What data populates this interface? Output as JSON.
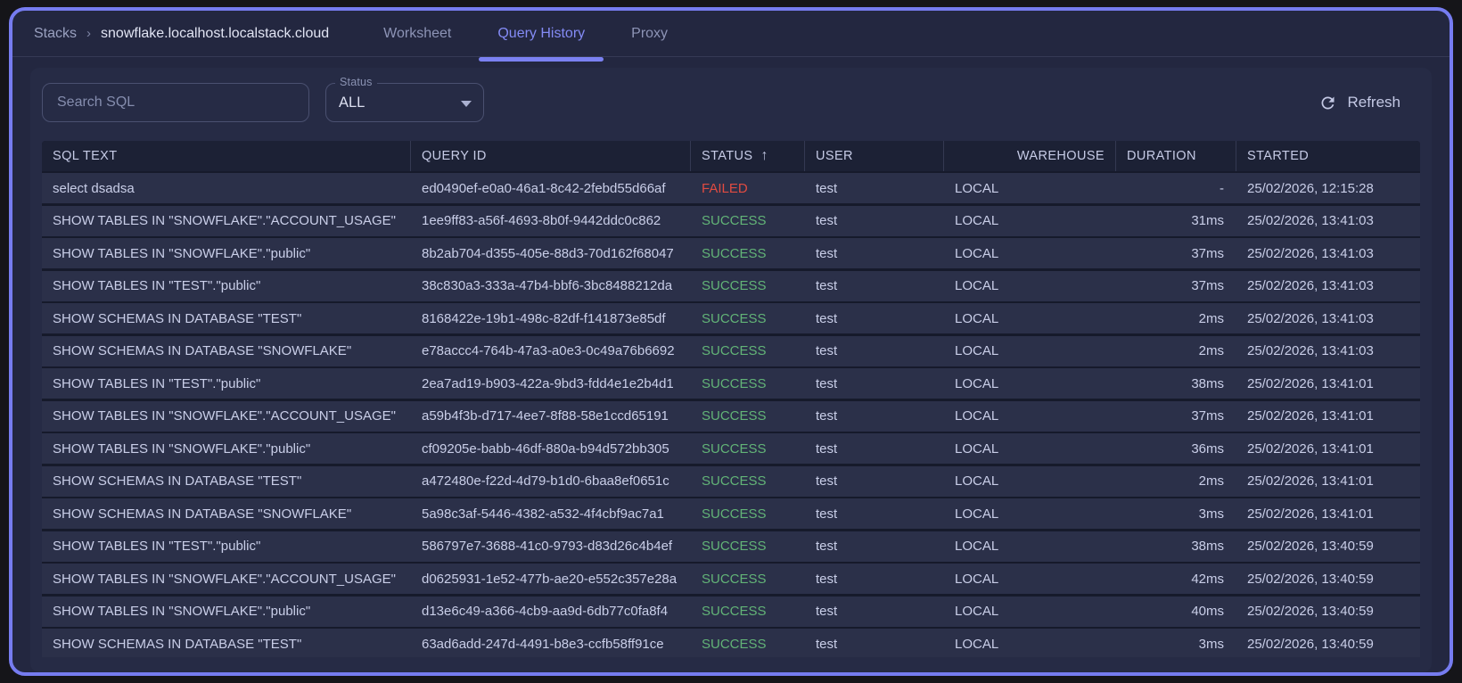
{
  "colors": {
    "accent": "#767cf0",
    "failed": "#e14b41",
    "success": "#62b377",
    "window_bg": "#232740",
    "card_bg": "#262b45",
    "row_bg": "#2b3049",
    "header_bg": "#1c2135"
  },
  "header": {
    "breadcrumb": {
      "root": "Stacks",
      "separator": "›",
      "current": "snowflake.localhost.localstack.cloud"
    },
    "tabs": [
      {
        "label": "Worksheet"
      },
      {
        "label": "Query History",
        "active": true
      },
      {
        "label": "Proxy"
      }
    ]
  },
  "toolbar": {
    "search_placeholder": "Search SQL",
    "status_filter": {
      "label": "Status",
      "value": "ALL"
    },
    "refresh_label": "Refresh"
  },
  "table": {
    "columns": [
      {
        "label": "SQL TEXT"
      },
      {
        "label": "QUERY ID"
      },
      {
        "label": "STATUS",
        "sort_icon": "↑"
      },
      {
        "label": "USER"
      },
      {
        "label": "WAREHOUSE"
      },
      {
        "label": "DURATION"
      },
      {
        "label": "STARTED"
      }
    ],
    "rows": [
      {
        "sql": "select dsadsa",
        "query_id": "ed0490ef-e0a0-46a1-8c42-2febd55d66af",
        "status": "FAILED",
        "user": "test",
        "warehouse": "LOCAL",
        "duration": "-",
        "started": "25/02/2026, 12:15:28"
      },
      {
        "sql": "SHOW TABLES IN \"SNOWFLAKE\".\"ACCOUNT_USAGE\"",
        "query_id": "1ee9ff83-a56f-4693-8b0f-9442ddc0c862",
        "status": "SUCCESS",
        "user": "test",
        "warehouse": "LOCAL",
        "duration": "31ms",
        "started": "25/02/2026, 13:41:03"
      },
      {
        "sql": "SHOW TABLES IN \"SNOWFLAKE\".\"public\"",
        "query_id": "8b2ab704-d355-405e-88d3-70d162f68047",
        "status": "SUCCESS",
        "user": "test",
        "warehouse": "LOCAL",
        "duration": "37ms",
        "started": "25/02/2026, 13:41:03"
      },
      {
        "sql": "SHOW TABLES IN \"TEST\".\"public\"",
        "query_id": "38c830a3-333a-47b4-bbf6-3bc8488212da",
        "status": "SUCCESS",
        "user": "test",
        "warehouse": "LOCAL",
        "duration": "37ms",
        "started": "25/02/2026, 13:41:03"
      },
      {
        "sql": "SHOW SCHEMAS IN DATABASE \"TEST\"",
        "query_id": "8168422e-19b1-498c-82df-f141873e85df",
        "status": "SUCCESS",
        "user": "test",
        "warehouse": "LOCAL",
        "duration": "2ms",
        "started": "25/02/2026, 13:41:03"
      },
      {
        "sql": "SHOW SCHEMAS IN DATABASE \"SNOWFLAKE\"",
        "query_id": "e78accc4-764b-47a3-a0e3-0c49a76b6692",
        "status": "SUCCESS",
        "user": "test",
        "warehouse": "LOCAL",
        "duration": "2ms",
        "started": "25/02/2026, 13:41:03"
      },
      {
        "sql": "SHOW TABLES IN \"TEST\".\"public\"",
        "query_id": "2ea7ad19-b903-422a-9bd3-fdd4e1e2b4d1",
        "status": "SUCCESS",
        "user": "test",
        "warehouse": "LOCAL",
        "duration": "38ms",
        "started": "25/02/2026, 13:41:01"
      },
      {
        "sql": "SHOW TABLES IN \"SNOWFLAKE\".\"ACCOUNT_USAGE\"",
        "query_id": "a59b4f3b-d717-4ee7-8f88-58e1ccd65191",
        "status": "SUCCESS",
        "user": "test",
        "warehouse": "LOCAL",
        "duration": "37ms",
        "started": "25/02/2026, 13:41:01"
      },
      {
        "sql": "SHOW TABLES IN \"SNOWFLAKE\".\"public\"",
        "query_id": "cf09205e-babb-46df-880a-b94d572bb305",
        "status": "SUCCESS",
        "user": "test",
        "warehouse": "LOCAL",
        "duration": "36ms",
        "started": "25/02/2026, 13:41:01"
      },
      {
        "sql": "SHOW SCHEMAS IN DATABASE \"TEST\"",
        "query_id": "a472480e-f22d-4d79-b1d0-6baa8ef0651c",
        "status": "SUCCESS",
        "user": "test",
        "warehouse": "LOCAL",
        "duration": "2ms",
        "started": "25/02/2026, 13:41:01"
      },
      {
        "sql": "SHOW SCHEMAS IN DATABASE \"SNOWFLAKE\"",
        "query_id": "5a98c3af-5446-4382-a532-4f4cbf9ac7a1",
        "status": "SUCCESS",
        "user": "test",
        "warehouse": "LOCAL",
        "duration": "3ms",
        "started": "25/02/2026, 13:41:01"
      },
      {
        "sql": "SHOW TABLES IN \"TEST\".\"public\"",
        "query_id": "586797e7-3688-41c0-9793-d83d26c4b4ef",
        "status": "SUCCESS",
        "user": "test",
        "warehouse": "LOCAL",
        "duration": "38ms",
        "started": "25/02/2026, 13:40:59"
      },
      {
        "sql": "SHOW TABLES IN \"SNOWFLAKE\".\"ACCOUNT_USAGE\"",
        "query_id": "d0625931-1e52-477b-ae20-e552c357e28a",
        "status": "SUCCESS",
        "user": "test",
        "warehouse": "LOCAL",
        "duration": "42ms",
        "started": "25/02/2026, 13:40:59"
      },
      {
        "sql": "SHOW TABLES IN \"SNOWFLAKE\".\"public\"",
        "query_id": "d13e6c49-a366-4cb9-aa9d-6db77c0fa8f4",
        "status": "SUCCESS",
        "user": "test",
        "warehouse": "LOCAL",
        "duration": "40ms",
        "started": "25/02/2026, 13:40:59"
      },
      {
        "sql": "SHOW SCHEMAS IN DATABASE \"TEST\"",
        "query_id": "63ad6add-247d-4491-b8e3-ccfb58ff91ce",
        "status": "SUCCESS",
        "user": "test",
        "warehouse": "LOCAL",
        "duration": "3ms",
        "started": "25/02/2026, 13:40:59"
      }
    ]
  }
}
